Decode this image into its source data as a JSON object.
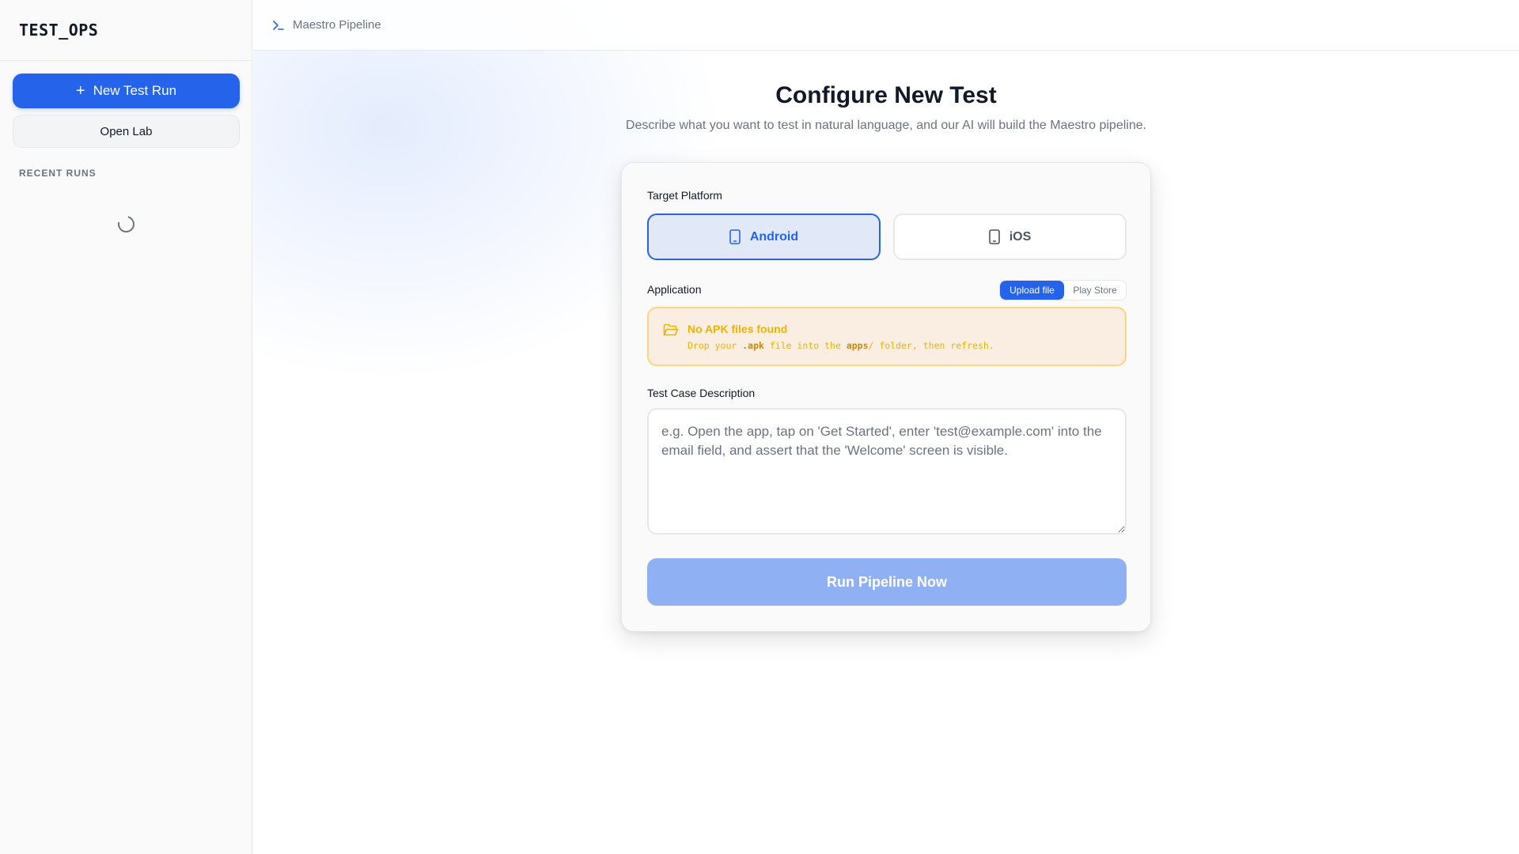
{
  "sidebar": {
    "brand": "TEST_OPS",
    "new_run_label": "New Test Run",
    "open_lab_label": "Open Lab",
    "recent_runs_label": "RECENT RUNS"
  },
  "topbar": {
    "title": "Maestro Pipeline",
    "icon": "terminal-icon"
  },
  "page": {
    "title": "Configure New Test",
    "subtitle": "Describe what you want to test in natural language, and our AI will build the Maestro pipeline."
  },
  "form": {
    "platform_label": "Target Platform",
    "platforms": [
      {
        "label": "Android",
        "selected": true,
        "icon": "phone-icon"
      },
      {
        "label": "iOS",
        "selected": false,
        "icon": "phone-icon"
      }
    ],
    "application_label": "Application",
    "app_source_options": [
      {
        "label": "Upload file",
        "selected": true
      },
      {
        "label": "Play Store",
        "selected": false
      }
    ],
    "warning": {
      "title": "No APK files found",
      "text_prefix": "Drop your ",
      "ext": ".apk",
      "text_mid": " file into the ",
      "folder": "apps",
      "text_suffix": "/ folder, then refresh.",
      "icon": "folder-open-icon"
    },
    "description_label": "Test Case Description",
    "description_value": "",
    "description_placeholder": "e.g. Open the app, tap on 'Get Started', enter 'test@example.com' into the email field, and assert that the 'Welcome' screen is visible.",
    "run_label": "Run Pipeline Now"
  },
  "colors": {
    "accent": "#2563eb",
    "run_disabled": "#8fb1f3",
    "warning_text": "#eab308",
    "warning_bg": "#faeee2"
  }
}
